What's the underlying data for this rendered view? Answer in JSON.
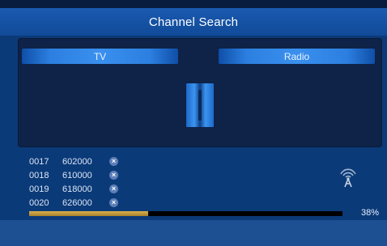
{
  "title": "Channel Search",
  "tabs": {
    "tv": "TV",
    "radio": "Radio"
  },
  "frequencies": [
    {
      "number": "0017",
      "frequency": "602000",
      "status_icon": "x-circle-icon"
    },
    {
      "number": "0018",
      "frequency": "610000",
      "status_icon": "x-circle-icon"
    },
    {
      "number": "0019",
      "frequency": "618000",
      "status_icon": "x-circle-icon"
    },
    {
      "number": "0020",
      "frequency": "626000",
      "status_icon": "x-circle-icon"
    }
  ],
  "signal_icon": "antenna-signal-icon",
  "progress": {
    "percent_value": 38,
    "label": "38%"
  },
  "colors": {
    "background": "#0b3a78",
    "title_bar": "#1a5ab0",
    "panel": "#0e2347",
    "tab_highlight": "#3a90ee",
    "progress_fill": "#d8b14e",
    "bottom_bar": "#1d4f93"
  }
}
